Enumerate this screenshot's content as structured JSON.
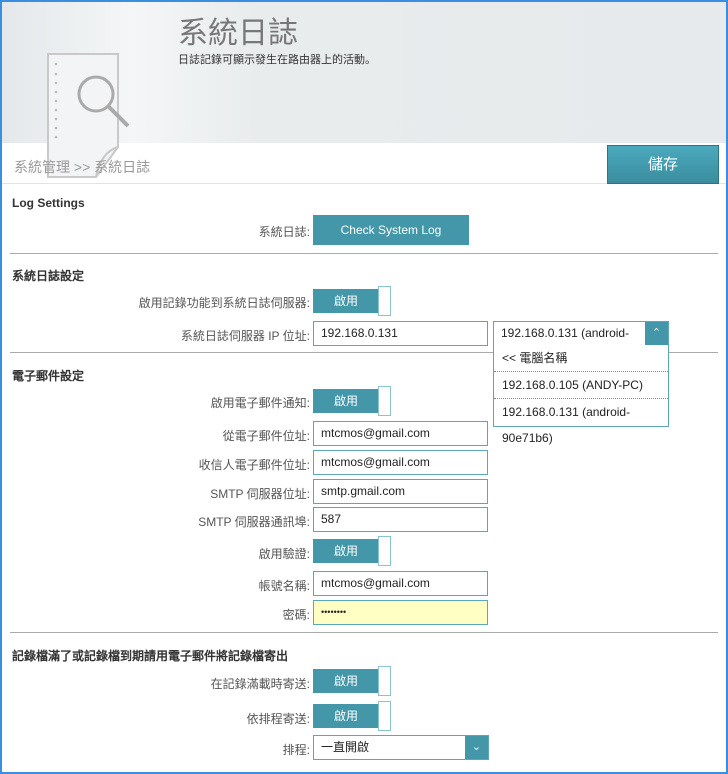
{
  "header": {
    "title": "系統日誌",
    "subtitle": "日誌記錄可顯示發生在路由器上的活動。"
  },
  "breadcrumb": "系統管理 >> 系統日誌",
  "save_label": "儲存",
  "log_settings": {
    "heading": "Log Settings",
    "syslog_label": "系統日誌:",
    "check_button": "Check System Log"
  },
  "syslog_section": {
    "heading": "系統日誌設定",
    "enable_label": "啟用記錄功能到系統日誌伺服器:",
    "enable_value": "啟用",
    "ip_label": "系統日誌伺服器 IP 位址:",
    "ip_value": "192.168.0.131",
    "computer_select": "192.168.0.131 (android-",
    "dropdown_options": [
      "<< 電腦名稱",
      "192.168.0.105 (ANDY-PC)",
      "192.168.0.131 (android-90e71b6)"
    ]
  },
  "email_section": {
    "heading": "電子郵件設定",
    "enable_label": "啟用電子郵件通知:",
    "enable_value": "啟用",
    "from_label": "從電子郵件位址:",
    "from_value": "mtcmos@gmail.com",
    "to_label": "收信人電子郵件位址:",
    "to_value": "mtcmos@gmail.com",
    "smtp_label": "SMTP 伺服器位址:",
    "smtp_value": "smtp.gmail.com",
    "port_label": "SMTP 伺服器通訊埠:",
    "port_value": "587",
    "auth_label": "啟用驗證:",
    "auth_value": "啟用",
    "account_label": "帳號名稱:",
    "account_value": "mtcmos@gmail.com",
    "password_label": "密碼:",
    "password_value": "••••••••"
  },
  "send_section": {
    "heading": "記錄檔滿了或記錄檔到期請用電子郵件將記錄檔寄出",
    "full_label": "在記錄滿載時寄送:",
    "full_value": "啟用",
    "schedule_send_label": "依排程寄送:",
    "schedule_send_value": "啟用",
    "schedule_label": "排程:",
    "schedule_value": "一直開啟"
  }
}
